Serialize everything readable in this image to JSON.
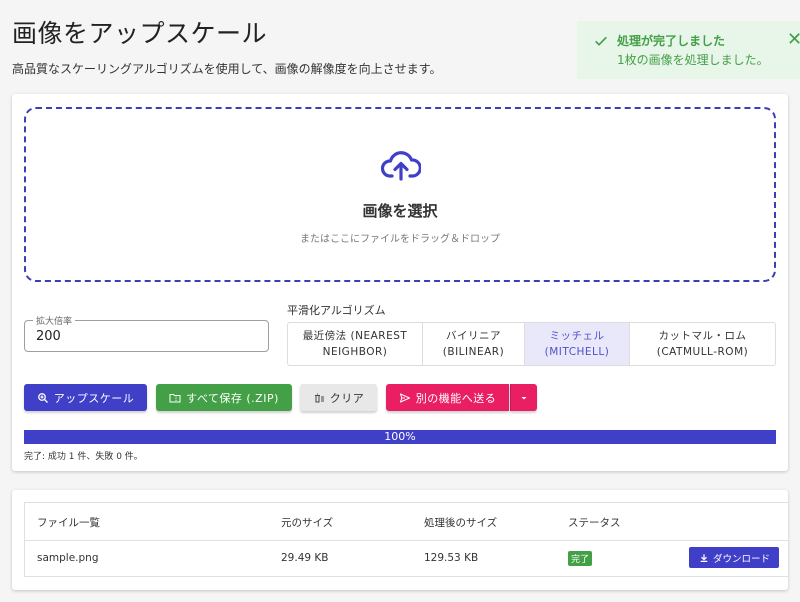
{
  "header": {
    "title": "画像をアップスケール",
    "subtitle": "高品質なスケーリングアルゴリズムを使用して、画像の解像度を向上させます。"
  },
  "toast": {
    "title": "処理が完了しました",
    "message": "1枚の画像を処理しました。",
    "close": "✕",
    "color": "#43a047"
  },
  "dropzone": {
    "icon": "cloud-upload-icon",
    "title": "画像を選択",
    "hint": "またはここにファイルをドラッグ＆ドロップ"
  },
  "scale": {
    "label": "拡大倍率",
    "value": "200"
  },
  "algorithm": {
    "label": "平滑化アルゴリズム",
    "options": [
      {
        "label": "最近傍法 (NEAREST\nNEIGHBOR)",
        "active": false
      },
      {
        "label": "バイリニア\n(BILINEAR)",
        "active": false
      },
      {
        "label": "ミッチェル\n(MITCHELL)",
        "active": true
      },
      {
        "label": "カットマル・ロム\n(CATMULL-ROM)",
        "active": false
      }
    ]
  },
  "actions": {
    "upscale": "アップスケール",
    "save_all": "すべて保存 (.ZIP)",
    "clear": "クリア",
    "send": "別の機能へ送る"
  },
  "progress": {
    "value": 100,
    "text": "100%",
    "status": "完了: 成功 1 件、失敗 0 件。"
  },
  "table": {
    "headers": [
      "ファイル一覧",
      "元のサイズ",
      "処理後のサイズ",
      "ステータス"
    ],
    "rows": [
      {
        "name": "sample.png",
        "original": "29.49 KB",
        "processed": "129.53 KB",
        "status": "完了",
        "action": "ダウンロード"
      }
    ]
  },
  "colors": {
    "primary": "#3f3fc8",
    "success": "#43a047",
    "accent": "#e91e63"
  }
}
